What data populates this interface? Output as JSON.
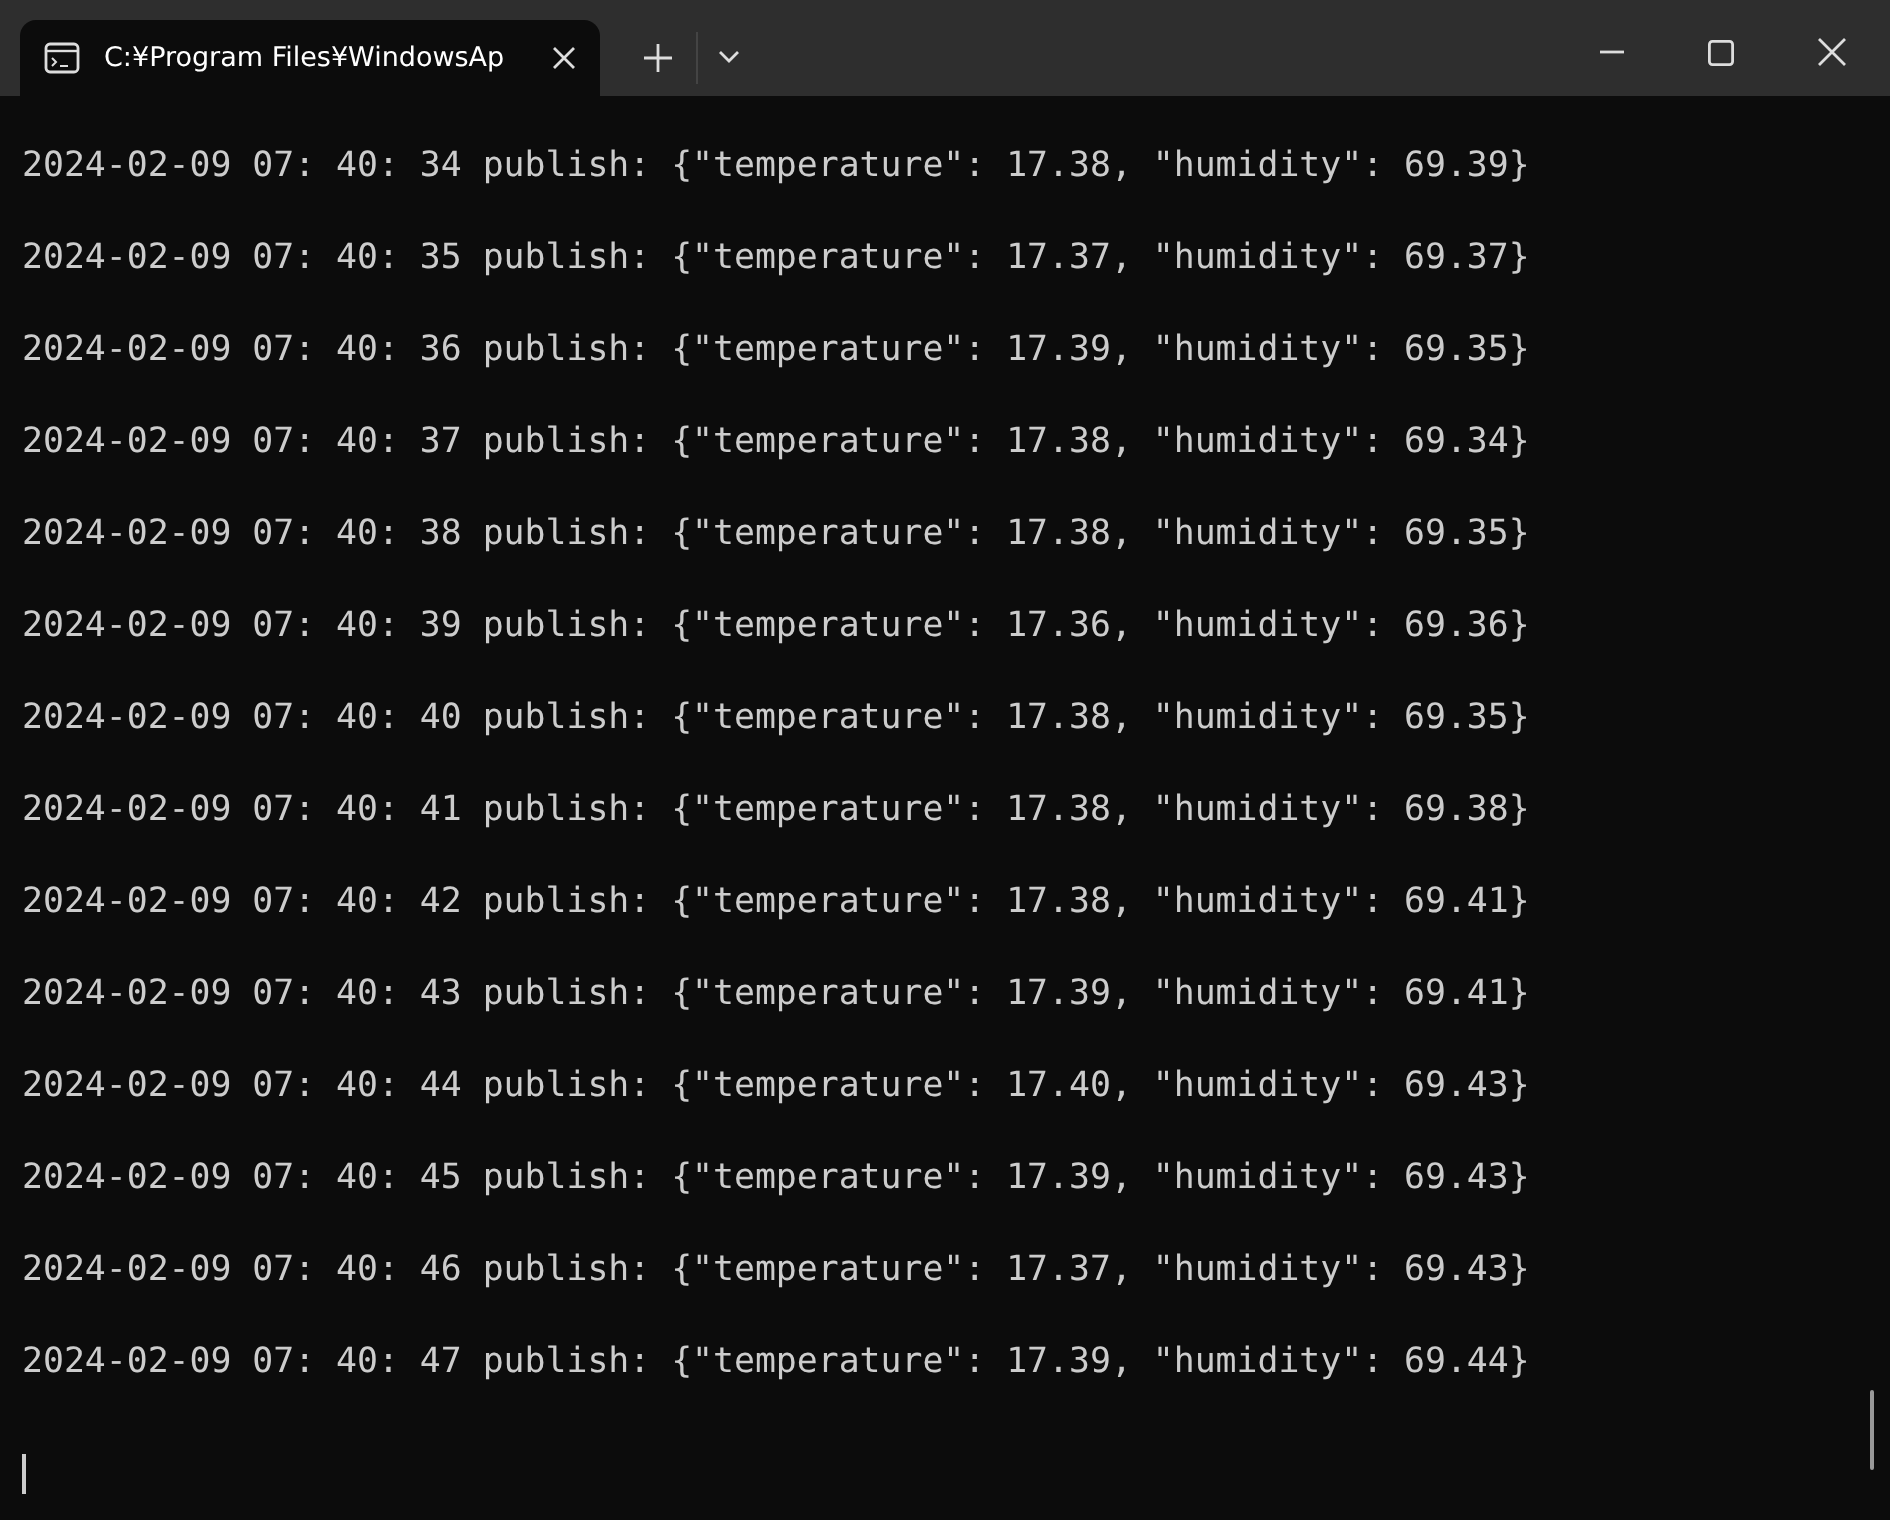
{
  "tab": {
    "title": "C:¥Program Files¥WindowsAp",
    "selected": true
  },
  "lines": [
    "2024-02-09 07: 40: 34 publish: {\"temperature\": 17.38, \"humidity\": 69.39}",
    "2024-02-09 07: 40: 35 publish: {\"temperature\": 17.37, \"humidity\": 69.37}",
    "2024-02-09 07: 40: 36 publish: {\"temperature\": 17.39, \"humidity\": 69.35}",
    "2024-02-09 07: 40: 37 publish: {\"temperature\": 17.38, \"humidity\": 69.34}",
    "2024-02-09 07: 40: 38 publish: {\"temperature\": 17.38, \"humidity\": 69.35}",
    "2024-02-09 07: 40: 39 publish: {\"temperature\": 17.36, \"humidity\": 69.36}",
    "2024-02-09 07: 40: 40 publish: {\"temperature\": 17.38, \"humidity\": 69.35}",
    "2024-02-09 07: 40: 41 publish: {\"temperature\": 17.38, \"humidity\": 69.38}",
    "2024-02-09 07: 40: 42 publish: {\"temperature\": 17.38, \"humidity\": 69.41}",
    "2024-02-09 07: 40: 43 publish: {\"temperature\": 17.39, \"humidity\": 69.41}",
    "2024-02-09 07: 40: 44 publish: {\"temperature\": 17.40, \"humidity\": 69.43}",
    "2024-02-09 07: 40: 45 publish: {\"temperature\": 17.39, \"humidity\": 69.43}",
    "2024-02-09 07: 40: 46 publish: {\"temperature\": 17.37, \"humidity\": 69.43}",
    "2024-02-09 07: 40: 47 publish: {\"temperature\": 17.39, \"humidity\": 69.44}"
  ]
}
